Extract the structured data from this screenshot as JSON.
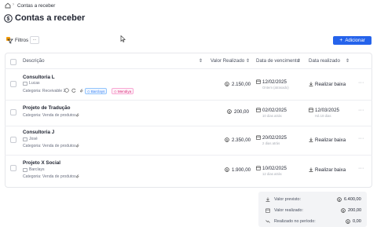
{
  "breadcrumb": {
    "page": "Contas a receber"
  },
  "page": {
    "title": "Contas a receber"
  },
  "toolbar": {
    "filters_label": "Filtros",
    "more_label": "···",
    "add_label": "Adicionar"
  },
  "table": {
    "headers": [
      "Descrição",
      "Valor Realizado",
      "Data de vencimento",
      "Data realizado"
    ],
    "rows": [
      {
        "name": "Consultoria L",
        "sub": "Lucas",
        "category": "Categoria: Receivable 2",
        "tags": [
          "Barclays",
          "Mendiya"
        ],
        "amount": "2.150,00",
        "due_date": "12/02/2025",
        "due_note": "Ontem (atrasado)",
        "realized_date": "",
        "realized_note": "",
        "action": "Realizar baixa"
      },
      {
        "name": "Projeto de Tradução",
        "sub": "",
        "category": "Categoria: Venda de produtos",
        "tags": [],
        "amount": "200,00",
        "due_date": "02/02/2025",
        "due_note": "10 dias atrás",
        "realized_date": "12/03/2025",
        "realized_note": "Há 18 dias",
        "action": ""
      },
      {
        "name": "Consultoria J",
        "sub": "José",
        "category": "Categoria: Venda de produtos",
        "tags": [],
        "amount": "2.350,00",
        "due_date": "20/02/2025",
        "due_note": "2 dias atrás",
        "realized_date": "",
        "realized_note": "",
        "action": "Realizar baixa"
      },
      {
        "name": "Projeto X Social",
        "sub": "Barclays",
        "category": "Categoria: Venda de produtos",
        "tags": [],
        "amount": "1.900,00",
        "due_date": "10/02/2025",
        "due_note": "12 dias atrás",
        "realized_date": "",
        "realized_note": "",
        "action": "Realizar baixa"
      }
    ]
  },
  "summary": {
    "items": [
      {
        "label": "Valor previsto:",
        "value": "6.400,00"
      },
      {
        "label": "Valor realizado:",
        "value": "200,00"
      },
      {
        "label": "Realizado no período:",
        "value": "0,00"
      }
    ]
  },
  "colors": {
    "accent": "#2563eb",
    "tag_blue": "#3b82f6",
    "tag_pink": "#db2777"
  }
}
